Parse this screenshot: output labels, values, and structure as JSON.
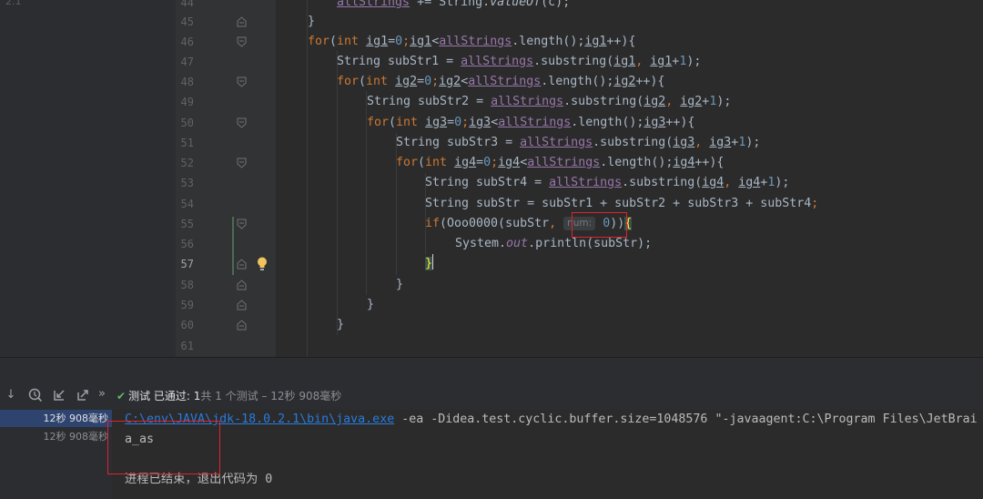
{
  "editor": {
    "top_left_number": "2.1",
    "lines": [
      {
        "number": "44"
      },
      {
        "number": "45"
      },
      {
        "number": "46"
      },
      {
        "number": "47"
      },
      {
        "number": "48"
      },
      {
        "number": "49"
      },
      {
        "number": "50"
      },
      {
        "number": "51"
      },
      {
        "number": "52"
      },
      {
        "number": "53"
      },
      {
        "number": "54"
      },
      {
        "number": "55"
      },
      {
        "number": "56"
      },
      {
        "number": "57"
      },
      {
        "number": "58"
      },
      {
        "number": "59"
      },
      {
        "number": "60"
      },
      {
        "number": "61"
      }
    ],
    "tokens": {
      "l44_a": "allStrings",
      "l44_b": " += String.",
      "l44_c": "valueOf",
      "l44_d": "(c);",
      "l45": "}",
      "for": "for",
      "int": "int",
      "l46_a": "(",
      "l46_b": " ",
      "l46_c": "ig1",
      "l46_d": "=",
      "l46_e": "0",
      "l46_f": ";",
      "l46_g": "ig1",
      "l46_h": "<",
      "l46_i": "allStrings",
      "l46_j": ".length();",
      "l46_k": "ig1",
      "l46_l": "++){",
      "l47_a": "String subStr1 = ",
      "l47_b": "allStrings",
      "l47_c": ".substring(",
      "l47_d": "ig1",
      "l47_e": ", ",
      "l47_f": "ig1",
      "l47_g": "+",
      "l47_h": "1",
      "l47_i": ");",
      "l48_a": "(",
      "l48_c": "ig2",
      "l48_d": "=",
      "l48_e": "0",
      "l48_f": ";",
      "l48_g": "ig2",
      "l48_h": "<",
      "l48_i": "allStrings",
      "l48_j": ".length();",
      "l48_k": "ig2",
      "l48_l": "++){",
      "l49_a": "String subStr2 = ",
      "l49_b": "allStrings",
      "l49_c": ".substring(",
      "l49_d": "ig2",
      "l49_e": ", ",
      "l49_f": "ig2",
      "l49_g": "+",
      "l49_h": "1",
      "l49_i": ");",
      "l50_a": "(",
      "l50_c": "ig3",
      "l50_d": "=",
      "l50_e": "0",
      "l50_f": ";",
      "l50_g": "ig3",
      "l50_h": "<",
      "l50_i": "allStrings",
      "l50_j": ".length();",
      "l50_k": "ig3",
      "l50_l": "++){",
      "l51_a": "String subStr3 = ",
      "l51_b": "allStrings",
      "l51_c": ".substring(",
      "l51_d": "ig3",
      "l51_e": ", ",
      "l51_f": "ig3",
      "l51_g": "+",
      "l51_h": "1",
      "l51_i": ");",
      "l52_a": "(",
      "l52_c": "ig4",
      "l52_d": "=",
      "l52_e": "0",
      "l52_f": ";",
      "l52_g": "ig4",
      "l52_h": "<",
      "l52_i": "allStrings",
      "l52_j": ".length();",
      "l52_k": "ig4",
      "l52_l": "++){",
      "l53_a": "String subStr4 = ",
      "l53_b": "allStrings",
      "l53_c": ".substring(",
      "l53_d": "ig4",
      "l53_e": ", ",
      "l53_f": "ig4",
      "l53_g": "+",
      "l53_h": "1",
      "l53_i": ");",
      "l54_a": "String subStr = subStr1 + subStr2 + subStr3 + subStr4",
      "l54_b": ";",
      "l55_a": "if",
      "l55_b": "(Ooo0000(subStr",
      "l55_c": ", ",
      "l55_hint": "num:",
      "l55_d": "0",
      "l55_e": "))",
      "l55_f": "{",
      "l56_a": "System.",
      "l56_b": "out",
      "l56_c": ".println(subStr);",
      "l57": "}",
      "l58": "}",
      "l59": "}",
      "l60": "}"
    }
  },
  "run": {
    "status_label": "测试 已通过:",
    "status_count": "1",
    "status_rest": "共 1 个测试 – 12秒 908毫秒",
    "tree": [
      "12秒 908毫秒",
      "12秒 908毫秒"
    ],
    "console": {
      "java_path": "C:\\env\\JAVA\\jdk-18.0.2.1\\bin\\java.exe",
      "args": " -ea -Didea.test.cyclic.buffer.size=1048576 \"-javaagent:C:\\Program Files\\JetBrai",
      "output": "a_as",
      "exit_message": "进程已结束，退出代码为 0"
    }
  },
  "colors": {
    "highlight_box": "#e0232e",
    "pass_check": "#5fb865"
  }
}
